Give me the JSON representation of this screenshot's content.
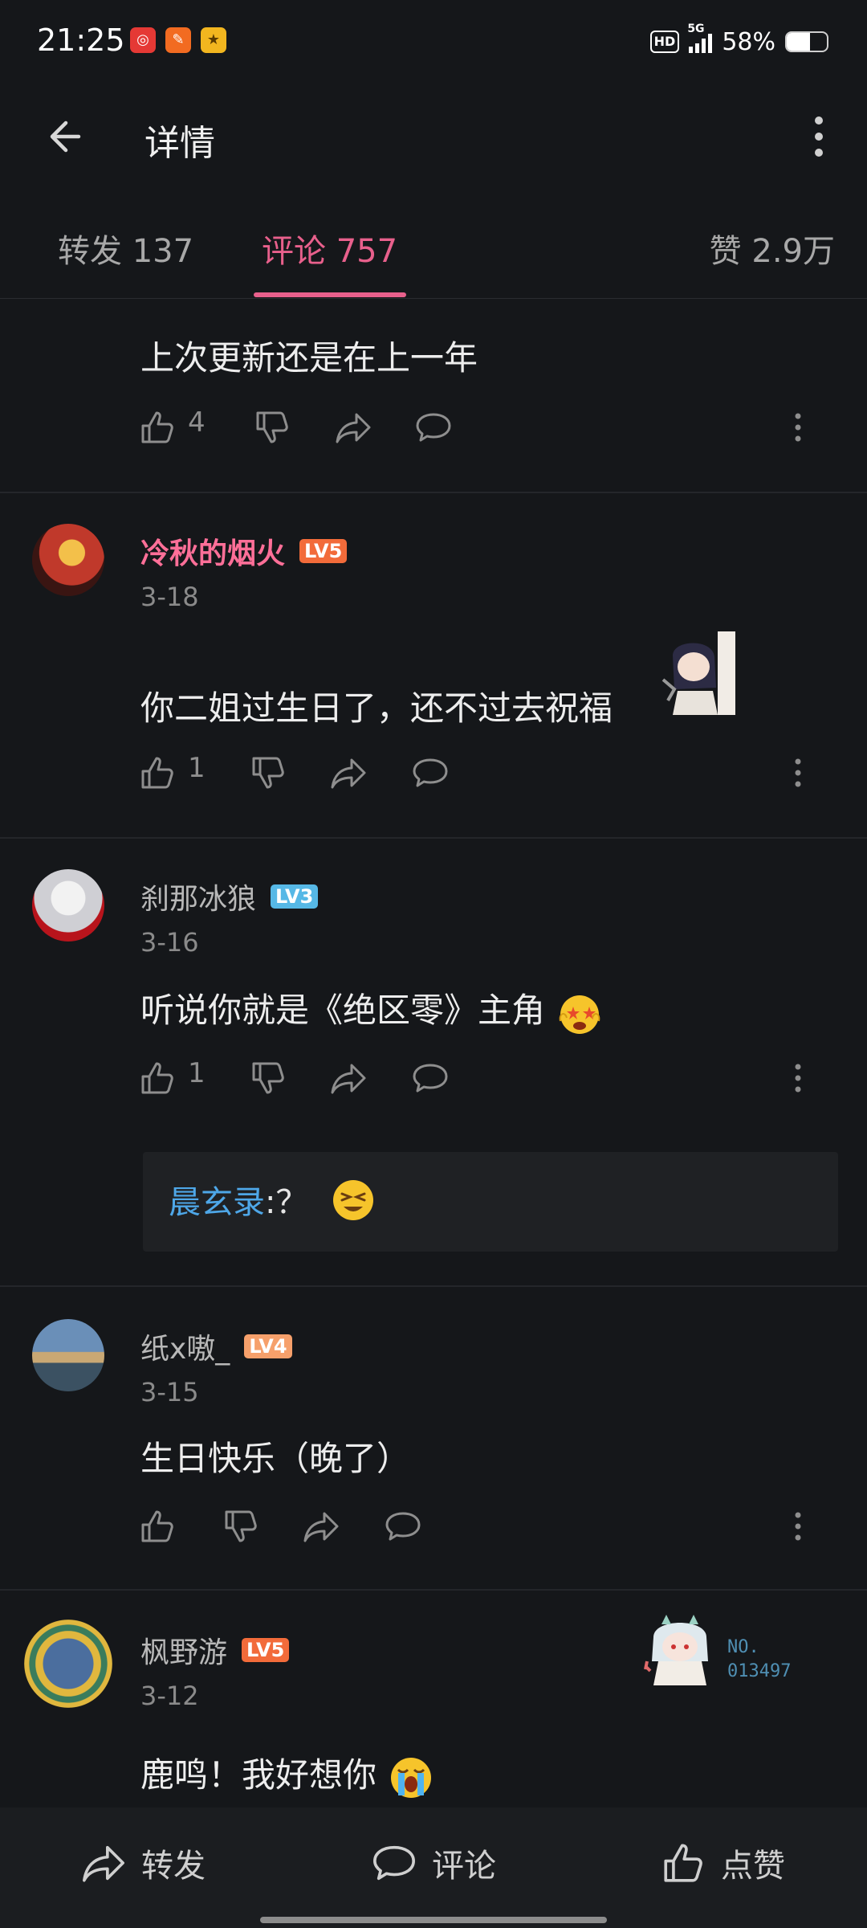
{
  "status_bar": {
    "time": "21:25",
    "network": "5G",
    "hd_badge": "HD",
    "battery_pct": "58%",
    "battery_level": 0.58
  },
  "header": {
    "title": "详情"
  },
  "tabs": [
    {
      "label": "转发 137",
      "active": false
    },
    {
      "label": "评论 757",
      "active": true
    },
    {
      "label": "赞 2.9万",
      "active": false
    }
  ],
  "comments": [
    {
      "text": "上次更新还是在上一年",
      "likes": "4"
    },
    {
      "username": "冷秋的烟火",
      "level": "LV5",
      "date": "3-18",
      "text": "你二姐过生日了，还不过去祝福",
      "likes": "1"
    },
    {
      "username": "刹那冰狼",
      "level": "LV3",
      "date": "3-16",
      "text": "听说你就是《绝区零》主角",
      "likes": "1",
      "reply": {
        "user": "晨玄录",
        "text": ":？"
      }
    },
    {
      "username": "纸x嗷_",
      "level": "LV4",
      "date": "3-15",
      "text": "生日快乐（晚了）"
    },
    {
      "username": "枫野游",
      "level": "LV5",
      "date": "3-12",
      "text": "鹿鸣！我好想你",
      "badge": "NO.\n013497"
    }
  ],
  "bottom_bar": {
    "repost": "转发",
    "comment": "评论",
    "like": "点赞"
  },
  "colors": {
    "accent": "#e8608c",
    "background": "#15171a",
    "reply_link": "#4ea7e8"
  }
}
